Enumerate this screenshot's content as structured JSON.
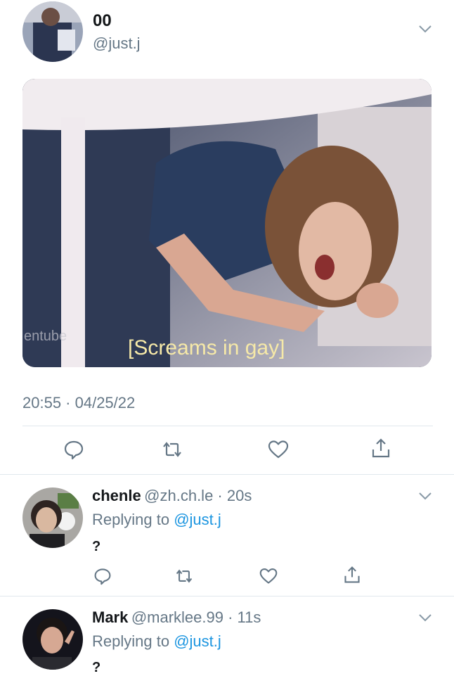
{
  "main_tweet": {
    "author_name": "00",
    "author_handle": "@just.j",
    "media_caption": "[Screams in gay]",
    "media_watermark": "entube",
    "timestamp": "20:55 · 04/25/22"
  },
  "replies": [
    {
      "name": "chenle",
      "handle": "@zh.ch.le",
      "time": "20s",
      "replying_prefix": "Replying to",
      "replying_handle": "@just.j",
      "text": "?"
    },
    {
      "name": "Mark",
      "handle": "@marklee.99",
      "time": "11s",
      "replying_prefix": "Replying to",
      "replying_handle": "@just.j",
      "text": "?"
    }
  ],
  "icons": {
    "reply": "reply-icon",
    "retweet": "retweet-icon",
    "like": "like-icon",
    "share": "share-icon",
    "menu": "chevron-down-icon"
  },
  "colors": {
    "accent": "#1b95e0",
    "secondary_text": "#657786",
    "divider": "#e1e8ed"
  }
}
